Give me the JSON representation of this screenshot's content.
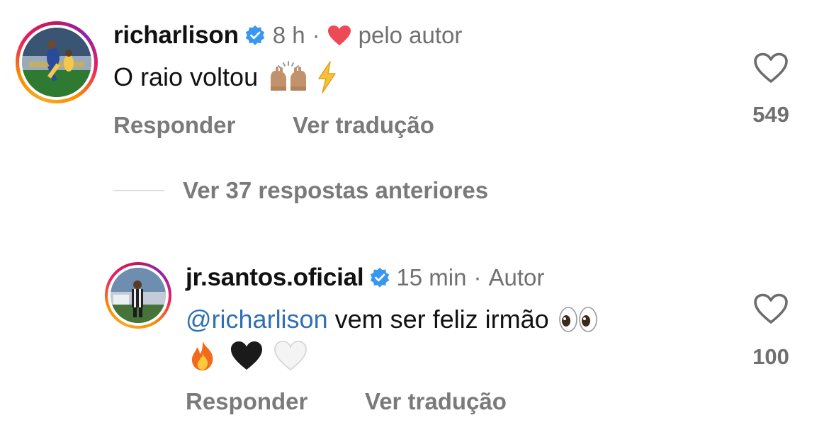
{
  "comment": {
    "username": "richarlison",
    "time": "8 h",
    "separator": "·",
    "liked_by_author_text": "pelo autor",
    "text": "O raio voltou",
    "emojis": [
      "raised-hands-emoji",
      "lightning-emoji"
    ],
    "like_count": "549",
    "reply_label": "Responder",
    "translate_label": "Ver tradução"
  },
  "view_replies": {
    "label": "Ver 37 respostas anteriores"
  },
  "reply": {
    "username": "jr.santos.oficial",
    "time": "15 min",
    "separator": "·",
    "author_badge": "Autor",
    "mention": "@richarlison",
    "text": " vem ser feliz irmão",
    "emojis": [
      "eyes-emoji",
      "fire-emoji",
      "black-heart-emoji",
      "white-heart-emoji"
    ],
    "like_count": "100",
    "reply_label": "Responder",
    "translate_label": "Ver tradução"
  },
  "colors": {
    "verified_blue": "#3897f0",
    "heart_red": "#ed4956",
    "mention_blue": "#2f6fb4",
    "secondary_text": "#707070"
  }
}
